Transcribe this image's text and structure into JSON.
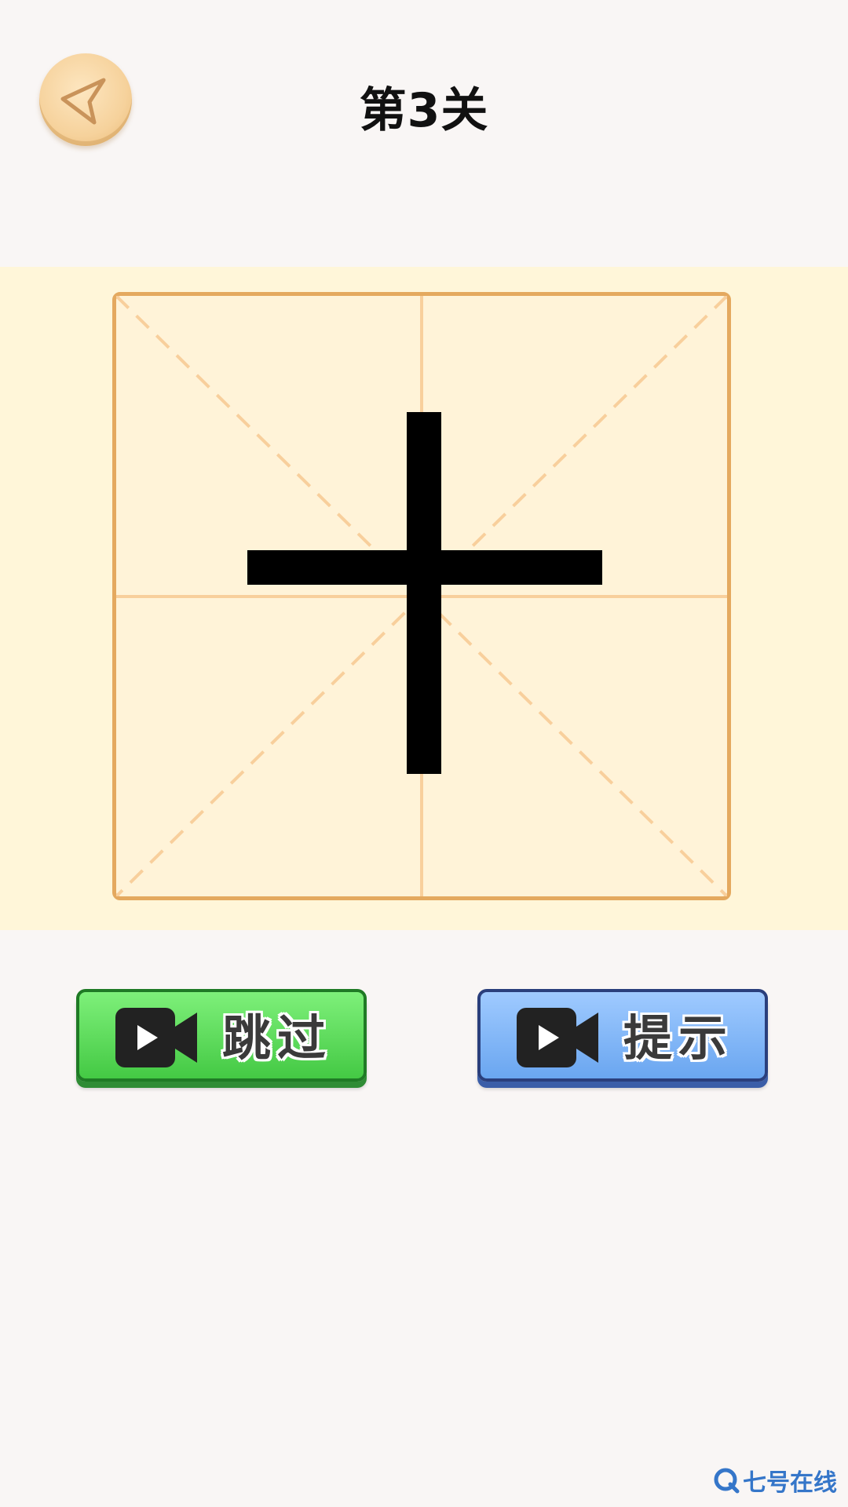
{
  "header": {
    "back_icon": "back-arrow-icon",
    "level_title": "第3关"
  },
  "board": {
    "character": "十",
    "grid_type": "米字格",
    "board_color": "#fff3d8",
    "border_color": "#e4a95f",
    "guide_color": "#f8cf9c"
  },
  "buttons": {
    "skip": {
      "label": "跳过",
      "icon": "video-camera-icon",
      "color": "#55d755"
    },
    "hint": {
      "label": "提示",
      "icon": "video-camera-icon",
      "color": "#7fb6f7"
    }
  },
  "watermark": {
    "text": "七号在线",
    "icon": "q-logo-icon"
  }
}
